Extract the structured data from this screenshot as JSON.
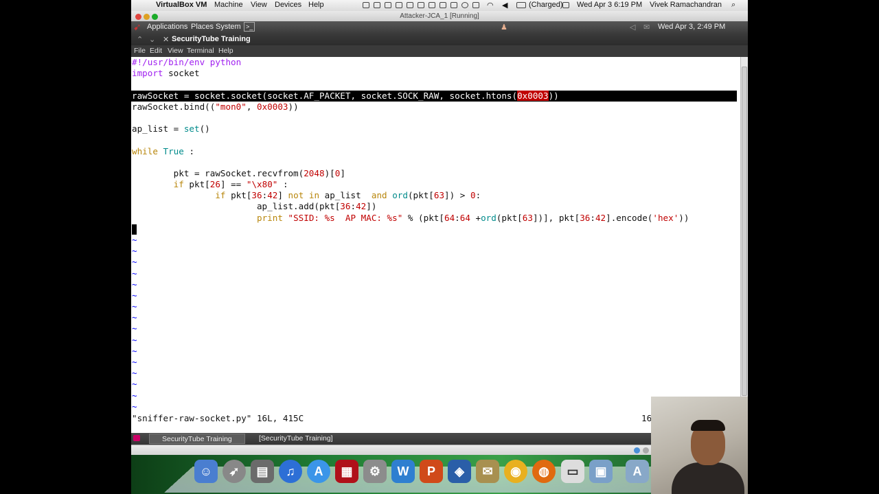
{
  "mac_menubar": {
    "app_name": "VirtualBox VM",
    "menus": [
      "Machine",
      "View",
      "Devices",
      "Help"
    ],
    "battery": "(Charged)",
    "clock": "Wed Apr 3  6:19 PM",
    "user": "Vivek Ramachandran"
  },
  "vm_window": {
    "title": "Attacker-JCA_1 [Running]"
  },
  "gnome_panel": {
    "menus": [
      "Applications",
      "Places",
      "System"
    ],
    "clock": "Wed Apr 3,  2:49 PM"
  },
  "terminal": {
    "title": "SecurityTube Training",
    "menus": [
      "File",
      "Edit",
      "View",
      "Terminal",
      "Help"
    ]
  },
  "editor": {
    "status_file": "\"sniffer-raw-socket.py\" 16L, 415C",
    "status_pos": "16"
  },
  "taskbar": {
    "items": [
      "SecurityTube Training",
      "[SecurityTube Training]"
    ]
  },
  "colors": {
    "keyword": "#a020f0",
    "keyword_alt": "#b8860b",
    "function": "#008b8b",
    "literal": "#c00000",
    "tilde": "#0000ff"
  }
}
